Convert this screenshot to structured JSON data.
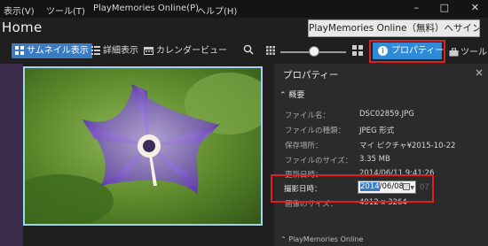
{
  "menubar": {
    "items": [
      {
        "label": "表示(V)"
      },
      {
        "label": "ツール(T)"
      },
      {
        "label": "PlayMemories Online(P)"
      },
      {
        "label": "ヘルプ(H)"
      }
    ]
  },
  "window_controls": {
    "minimize": "–",
    "maximize": "□",
    "close": "✕"
  },
  "header": {
    "title": "Home",
    "signin_label": "PlayMemories Online（無料）へサインイン"
  },
  "toolbar": {
    "thumbnail_label": "サムネイル表示",
    "detail_label": "詳細表示",
    "calendar_label": "カレンダービュー",
    "properties_label": "プロパティー",
    "properties_icon": "i",
    "tool_label": "ツール",
    "zoom_level": 0.52
  },
  "properties": {
    "title": "プロパティー",
    "section_label": "概要",
    "rows": [
      {
        "key": "ファイル名：",
        "value": "DSC02859.JPG"
      },
      {
        "key": "ファイルの種類：",
        "value": "JPEG 形式"
      },
      {
        "key": "保存場所：",
        "value": "マイ ピクチャ¥2015-10-22"
      },
      {
        "key": "ファイルのサイズ：",
        "value": "3.35 MB"
      },
      {
        "key": "更新日時：",
        "value": "2014/06/11 9:41:26"
      }
    ],
    "shoot_date": {
      "key": "撮影日時：",
      "year": "2014",
      "rest": "/06/08",
      "time_partial": "07"
    },
    "image_size": {
      "key": "画像のサイズ：",
      "value": "4912 x 3264"
    },
    "pmo_section": "PlayMemories Online"
  },
  "colors": {
    "accent": "#2f8ad8",
    "highlight_border": "#e02020",
    "background": "#1f1f1f"
  }
}
